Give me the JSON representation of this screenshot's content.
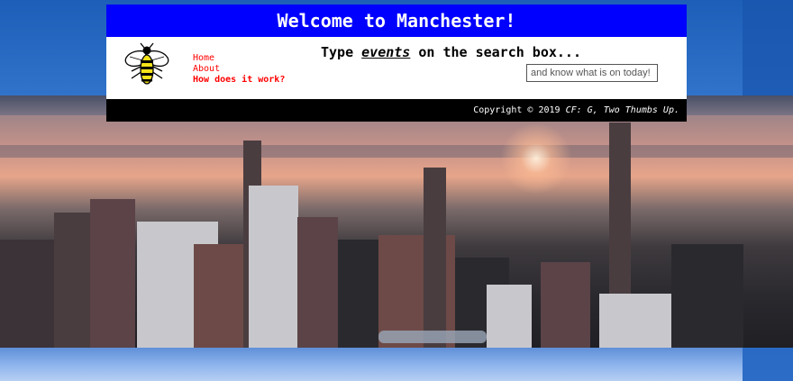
{
  "header": {
    "title": "Welcome to Manchester!"
  },
  "logo": {
    "icon": "worker-bee-icon",
    "colors": {
      "stripe_yellow": "#f5e31a",
      "stripe_black": "#000000"
    }
  },
  "nav": {
    "items": [
      {
        "label": "Home"
      },
      {
        "label": "About"
      },
      {
        "label": "How does it work?"
      }
    ],
    "link_color": "#ff0000"
  },
  "tagline": {
    "prefix": "Type ",
    "keyword": "events",
    "suffix": " on the search box..."
  },
  "search": {
    "placeholder": "and know what is on today!",
    "value": ""
  },
  "footer": {
    "copyright": "Copyright © 2019 ",
    "credit": "CF: G, Two Thumbs Up."
  },
  "colors": {
    "header_bg": "#0000ff",
    "footer_bg": "#000000",
    "body_bg": "#ffffff"
  }
}
